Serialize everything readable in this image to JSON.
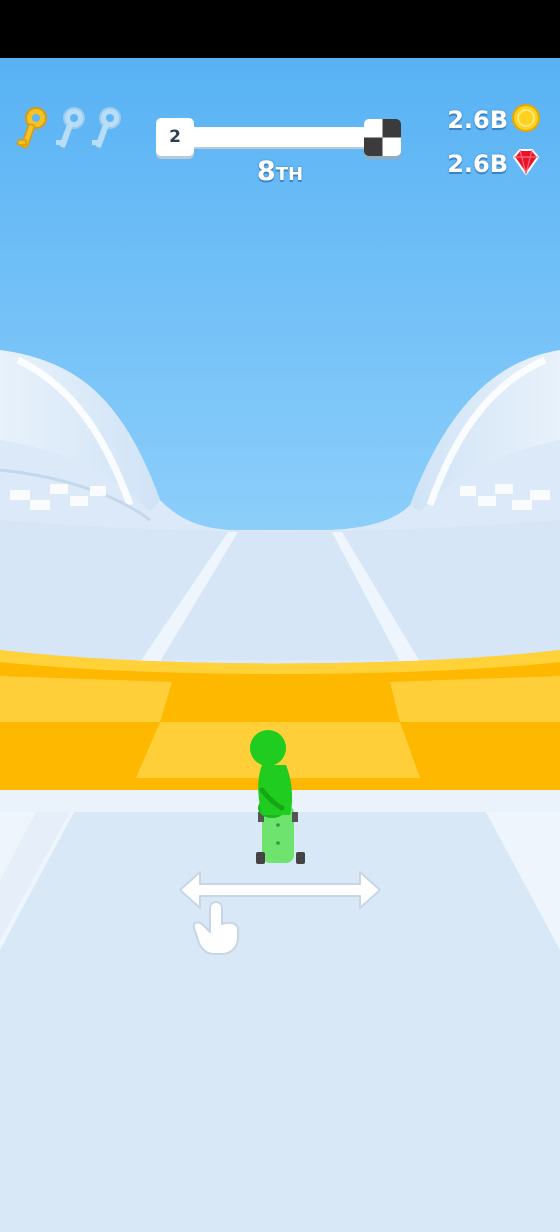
{
  "hud": {
    "keys": [
      {
        "icon": "key-icon",
        "collected": true
      },
      {
        "icon": "key-icon",
        "collected": false
      },
      {
        "icon": "key-icon",
        "collected": false
      }
    ],
    "level": "2",
    "level_progress": 0.02,
    "rank": {
      "number": "8",
      "suffix": "TH"
    },
    "coins": {
      "amount": "2.6B",
      "icon": "coin-icon"
    },
    "gems": {
      "amount": "2.6B",
      "icon": "gem-icon"
    }
  },
  "hint": {
    "icon": "swipe-hand-icon"
  },
  "colors": {
    "sky": "#5fb5f5",
    "track": "#d9e8f7",
    "stripe": "#ffb300",
    "player": "#1fcc1f",
    "key_collected": "#f6c324",
    "key_empty": "#b8ddf6",
    "coin": "#ffd21f",
    "gem": "#e8142a"
  }
}
